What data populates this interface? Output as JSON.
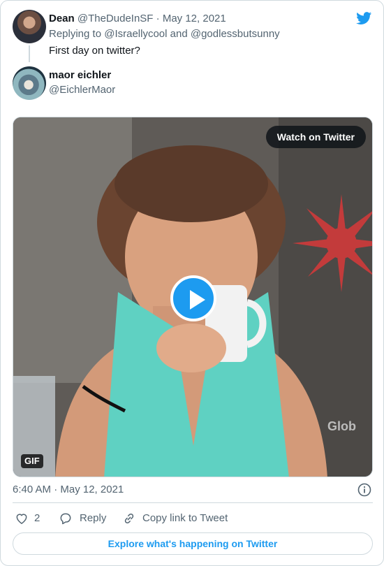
{
  "tweet": {
    "author_name": "Dean",
    "author_handle": "@TheDudeInSF",
    "separator": "·",
    "date": "May 12, 2021",
    "replying_prefix": "Replying to",
    "replying_to_1": "@Israellycool",
    "replying_and": "and",
    "replying_to_2": "@godlessbutsunny",
    "text": "First day on twitter?"
  },
  "quoted": {
    "author_name": "maor eichler",
    "author_handle": "@EichlerMaor"
  },
  "media": {
    "watch_label": "Watch on Twitter",
    "gif_badge": "GIF",
    "play_icon": "play-icon"
  },
  "footer": {
    "timestamp": "6:40 AM · May 12, 2021",
    "like_count": "2",
    "reply_label": "Reply",
    "copy_link_label": "Copy link to Tweet",
    "explore_label": "Explore what's happening on Twitter"
  },
  "colors": {
    "twitter_blue": "#1d9bf0",
    "secondary_text": "#536471",
    "border": "#cfd9de"
  }
}
